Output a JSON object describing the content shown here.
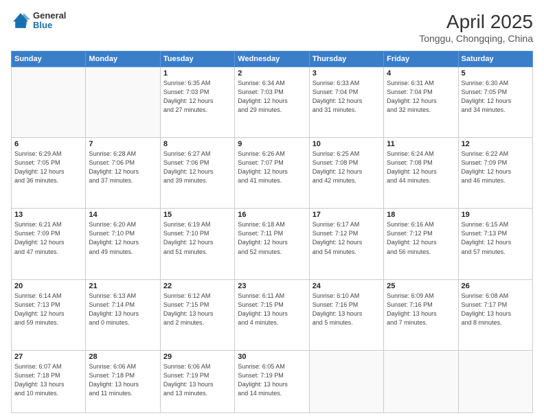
{
  "header": {
    "logo_general": "General",
    "logo_blue": "Blue",
    "month_title": "April 2025",
    "location": "Tonggu, Chongqing, China"
  },
  "weekdays": [
    "Sunday",
    "Monday",
    "Tuesday",
    "Wednesday",
    "Thursday",
    "Friday",
    "Saturday"
  ],
  "weeks": [
    [
      {
        "day": "",
        "detail": ""
      },
      {
        "day": "",
        "detail": ""
      },
      {
        "day": "1",
        "detail": "Sunrise: 6:35 AM\nSunset: 7:03 PM\nDaylight: 12 hours\nand 27 minutes."
      },
      {
        "day": "2",
        "detail": "Sunrise: 6:34 AM\nSunset: 7:03 PM\nDaylight: 12 hours\nand 29 minutes."
      },
      {
        "day": "3",
        "detail": "Sunrise: 6:33 AM\nSunset: 7:04 PM\nDaylight: 12 hours\nand 31 minutes."
      },
      {
        "day": "4",
        "detail": "Sunrise: 6:31 AM\nSunset: 7:04 PM\nDaylight: 12 hours\nand 32 minutes."
      },
      {
        "day": "5",
        "detail": "Sunrise: 6:30 AM\nSunset: 7:05 PM\nDaylight: 12 hours\nand 34 minutes."
      }
    ],
    [
      {
        "day": "6",
        "detail": "Sunrise: 6:29 AM\nSunset: 7:05 PM\nDaylight: 12 hours\nand 36 minutes."
      },
      {
        "day": "7",
        "detail": "Sunrise: 6:28 AM\nSunset: 7:06 PM\nDaylight: 12 hours\nand 37 minutes."
      },
      {
        "day": "8",
        "detail": "Sunrise: 6:27 AM\nSunset: 7:06 PM\nDaylight: 12 hours\nand 39 minutes."
      },
      {
        "day": "9",
        "detail": "Sunrise: 6:26 AM\nSunset: 7:07 PM\nDaylight: 12 hours\nand 41 minutes."
      },
      {
        "day": "10",
        "detail": "Sunrise: 6:25 AM\nSunset: 7:08 PM\nDaylight: 12 hours\nand 42 minutes."
      },
      {
        "day": "11",
        "detail": "Sunrise: 6:24 AM\nSunset: 7:08 PM\nDaylight: 12 hours\nand 44 minutes."
      },
      {
        "day": "12",
        "detail": "Sunrise: 6:22 AM\nSunset: 7:09 PM\nDaylight: 12 hours\nand 46 minutes."
      }
    ],
    [
      {
        "day": "13",
        "detail": "Sunrise: 6:21 AM\nSunset: 7:09 PM\nDaylight: 12 hours\nand 47 minutes."
      },
      {
        "day": "14",
        "detail": "Sunrise: 6:20 AM\nSunset: 7:10 PM\nDaylight: 12 hours\nand 49 minutes."
      },
      {
        "day": "15",
        "detail": "Sunrise: 6:19 AM\nSunset: 7:10 PM\nDaylight: 12 hours\nand 51 minutes."
      },
      {
        "day": "16",
        "detail": "Sunrise: 6:18 AM\nSunset: 7:11 PM\nDaylight: 12 hours\nand 52 minutes."
      },
      {
        "day": "17",
        "detail": "Sunrise: 6:17 AM\nSunset: 7:12 PM\nDaylight: 12 hours\nand 54 minutes."
      },
      {
        "day": "18",
        "detail": "Sunrise: 6:16 AM\nSunset: 7:12 PM\nDaylight: 12 hours\nand 56 minutes."
      },
      {
        "day": "19",
        "detail": "Sunrise: 6:15 AM\nSunset: 7:13 PM\nDaylight: 12 hours\nand 57 minutes."
      }
    ],
    [
      {
        "day": "20",
        "detail": "Sunrise: 6:14 AM\nSunset: 7:13 PM\nDaylight: 12 hours\nand 59 minutes."
      },
      {
        "day": "21",
        "detail": "Sunrise: 6:13 AM\nSunset: 7:14 PM\nDaylight: 13 hours\nand 0 minutes."
      },
      {
        "day": "22",
        "detail": "Sunrise: 6:12 AM\nSunset: 7:15 PM\nDaylight: 13 hours\nand 2 minutes."
      },
      {
        "day": "23",
        "detail": "Sunrise: 6:11 AM\nSunset: 7:15 PM\nDaylight: 13 hours\nand 4 minutes."
      },
      {
        "day": "24",
        "detail": "Sunrise: 6:10 AM\nSunset: 7:16 PM\nDaylight: 13 hours\nand 5 minutes."
      },
      {
        "day": "25",
        "detail": "Sunrise: 6:09 AM\nSunset: 7:16 PM\nDaylight: 13 hours\nand 7 minutes."
      },
      {
        "day": "26",
        "detail": "Sunrise: 6:08 AM\nSunset: 7:17 PM\nDaylight: 13 hours\nand 8 minutes."
      }
    ],
    [
      {
        "day": "27",
        "detail": "Sunrise: 6:07 AM\nSunset: 7:18 PM\nDaylight: 13 hours\nand 10 minutes."
      },
      {
        "day": "28",
        "detail": "Sunrise: 6:06 AM\nSunset: 7:18 PM\nDaylight: 13 hours\nand 11 minutes."
      },
      {
        "day": "29",
        "detail": "Sunrise: 6:06 AM\nSunset: 7:19 PM\nDaylight: 13 hours\nand 13 minutes."
      },
      {
        "day": "30",
        "detail": "Sunrise: 6:05 AM\nSunset: 7:19 PM\nDaylight: 13 hours\nand 14 minutes."
      },
      {
        "day": "",
        "detail": ""
      },
      {
        "day": "",
        "detail": ""
      },
      {
        "day": "",
        "detail": ""
      }
    ]
  ]
}
